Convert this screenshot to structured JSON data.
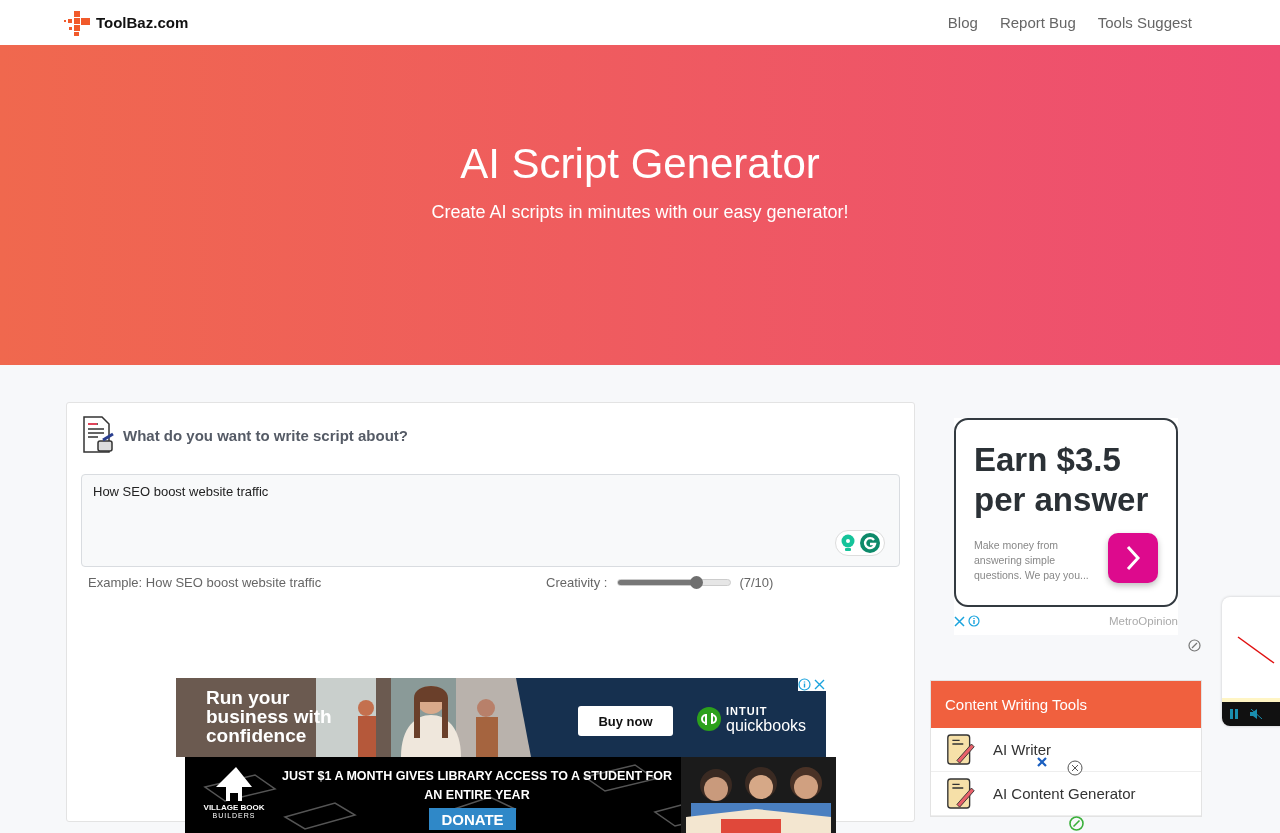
{
  "header": {
    "logo": "ToolBaz.com",
    "nav": [
      "Blog",
      "Report Bug",
      "Tools Suggest"
    ]
  },
  "hero": {
    "title": "AI Script Generator",
    "subtitle": "Create AI scripts in minutes with our easy generator!"
  },
  "tool_card": {
    "heading": "What do you want to write script about?",
    "input": {
      "value": "How SEO boost website traffic"
    },
    "example": "Example: How SEO boost website traffic",
    "creativity": {
      "label": "Creativity :",
      "level": 0.7,
      "reading": "(7/10)"
    }
  },
  "banner_ad": {
    "headline": "Run your business with confidence",
    "button": "Buy now",
    "brand_top": "INTUIT",
    "brand": "quickbooks"
  },
  "side_ad": {
    "headline": "Earn $3.5 per answer",
    "body": "Make money from answering simple questions. We pay you...",
    "advertiser": "MetroOpinion"
  },
  "sidebar": {
    "title": "Content Writing Tools",
    "items": [
      {
        "label": "AI Writer"
      },
      {
        "label": "AI Content Generator"
      }
    ]
  },
  "bottom_ad": {
    "logo_top": "VILLAGE BOOK",
    "logo_bottom": "BUILDERS",
    "message": "JUST $1 A MONTH GIVES LIBRARY ACCESS TO A STUDENT FOR AN ENTIRE YEAR",
    "button": "DONATE"
  }
}
